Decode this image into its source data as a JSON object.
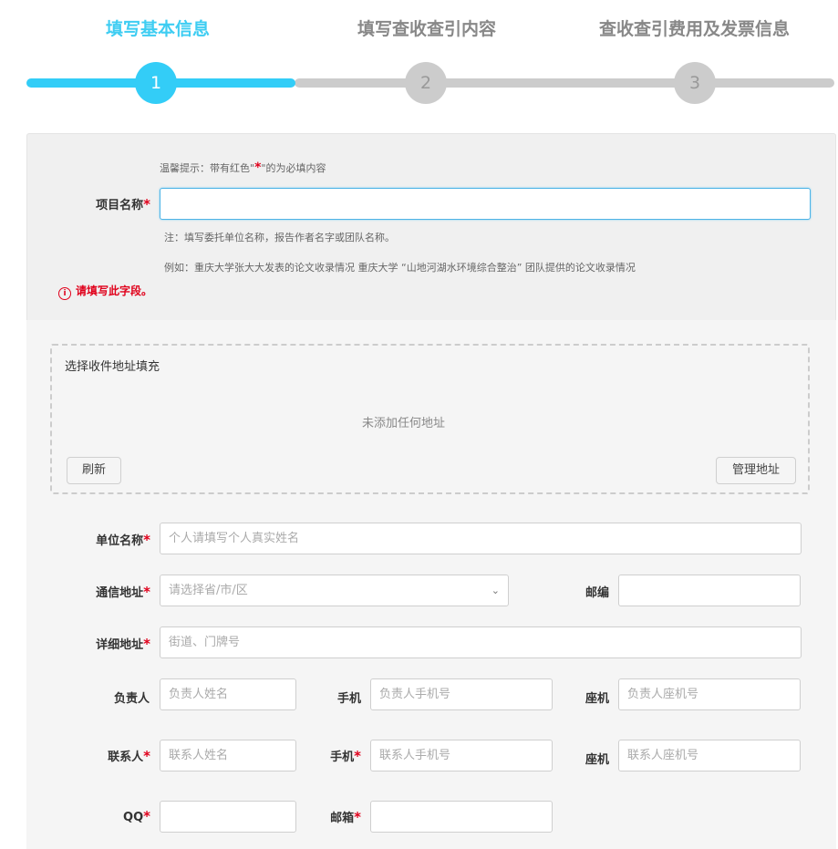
{
  "steps": [
    {
      "title": "填写基本信息",
      "number": "1",
      "active": true
    },
    {
      "title": "填写查收查引内容",
      "number": "2",
      "active": false
    },
    {
      "title": "查收查引费用及发票信息",
      "number": "3",
      "active": false
    }
  ],
  "colors": {
    "accent": "#33cdf7",
    "required": "#e0001b",
    "inactive": "#cccccc"
  },
  "project": {
    "hint_prefix": "温馨提示：带有红色\"",
    "hint_star": "*",
    "hint_suffix": "\"的为必填内容",
    "label": "项目名称",
    "required_mark": "*",
    "value": "",
    "note1": "注：填写委托单位名称，报告作者名字或团队名称。",
    "note2": "例如：重庆大学张大大发表的论文收录情况      重庆大学 “山地河湖水环境综合整治” 团队提供的论文收录情况",
    "error_icon": "warning-circle-icon",
    "error": "请填写此字段。"
  },
  "address_box": {
    "title": "选择收件地址填充",
    "empty_text": "未添加任何地址",
    "refresh_label": "刷新",
    "manage_label": "管理地址"
  },
  "form": {
    "unit_label": "单位名称",
    "unit_placeholder": "个人请填写个人真实姓名",
    "addr_label": "通信地址",
    "addr_placeholder": "请选择省/市/区",
    "zip_label": "邮编",
    "detail_label": "详细地址",
    "detail_placeholder": "街道、门牌号",
    "owner_label": "负责人",
    "owner_placeholder": "负责人姓名",
    "owner_mobile_label": "手机",
    "owner_mobile_placeholder": "负责人手机号",
    "owner_phone_label": "座机",
    "owner_phone_placeholder": "负责人座机号",
    "contact_label": "联系人",
    "contact_placeholder": "联系人姓名",
    "contact_mobile_label": "手机",
    "contact_mobile_placeholder": "联系人手机号",
    "contact_phone_label": "座机",
    "contact_phone_placeholder": "联系人座机号",
    "qq_label": "QQ",
    "email_label": "邮箱",
    "required_mark": "*"
  }
}
